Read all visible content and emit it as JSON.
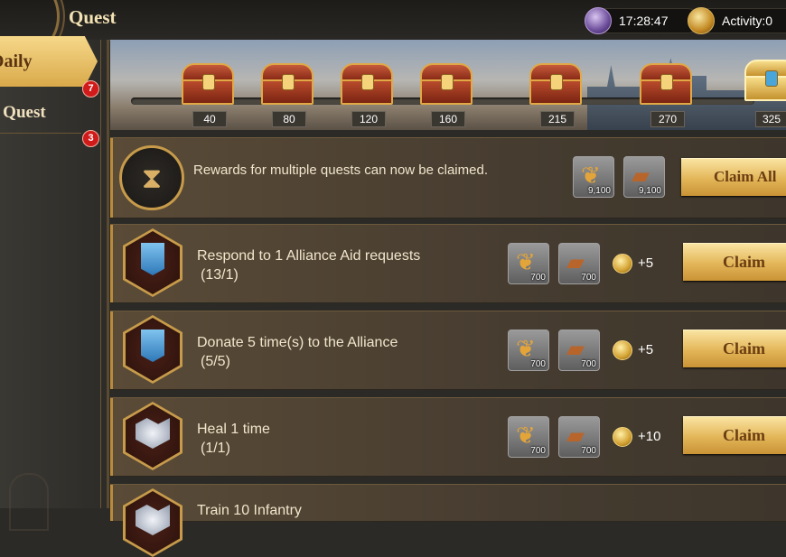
{
  "header": {
    "title": "Quest",
    "time": "17:28:47",
    "activity_label": "Activity:0"
  },
  "sidebar": {
    "tabs": [
      {
        "label": "Daily",
        "badge": "7",
        "active": true
      },
      {
        "label": "e Quest",
        "badge": "3",
        "active": false
      }
    ]
  },
  "chest_track": {
    "milestones": [
      "40",
      "80",
      "120",
      "160",
      "215",
      "270",
      "325"
    ]
  },
  "claim_all": {
    "message": "Rewards for multiple quests can now be claimed.",
    "rewards": [
      {
        "icon": "wheat-icon",
        "qty": "9,100"
      },
      {
        "icon": "wood-icon",
        "qty": "9,100"
      }
    ],
    "button": "Claim All"
  },
  "quests": [
    {
      "title": "Respond to 1 Alliance Aid requests",
      "progress": "(13/1)",
      "icon": "alliance-banner-icon",
      "rewards": [
        {
          "icon": "wheat-icon",
          "qty": "700"
        },
        {
          "icon": "wood-icon",
          "qty": "700"
        }
      ],
      "activity": "+5",
      "button": "Claim"
    },
    {
      "title": "Donate 5 time(s) to the Alliance",
      "progress": "(5/5)",
      "icon": "alliance-banner-icon",
      "rewards": [
        {
          "icon": "wheat-icon",
          "qty": "700"
        },
        {
          "icon": "wood-icon",
          "qty": "700"
        }
      ],
      "activity": "+5",
      "button": "Claim"
    },
    {
      "title": "Heal 1 time",
      "progress": "(1/1)",
      "icon": "heal-shield-icon",
      "rewards": [
        {
          "icon": "wheat-icon",
          "qty": "700"
        },
        {
          "icon": "wood-icon",
          "qty": "700"
        }
      ],
      "activity": "+10",
      "button": "Claim"
    }
  ],
  "partial_row": {
    "title": "Train 10 Infantry"
  },
  "colors": {
    "accent_gold": "#e3b659",
    "badge_red": "#d11b1b",
    "panel_brown": "#5a4b37"
  }
}
